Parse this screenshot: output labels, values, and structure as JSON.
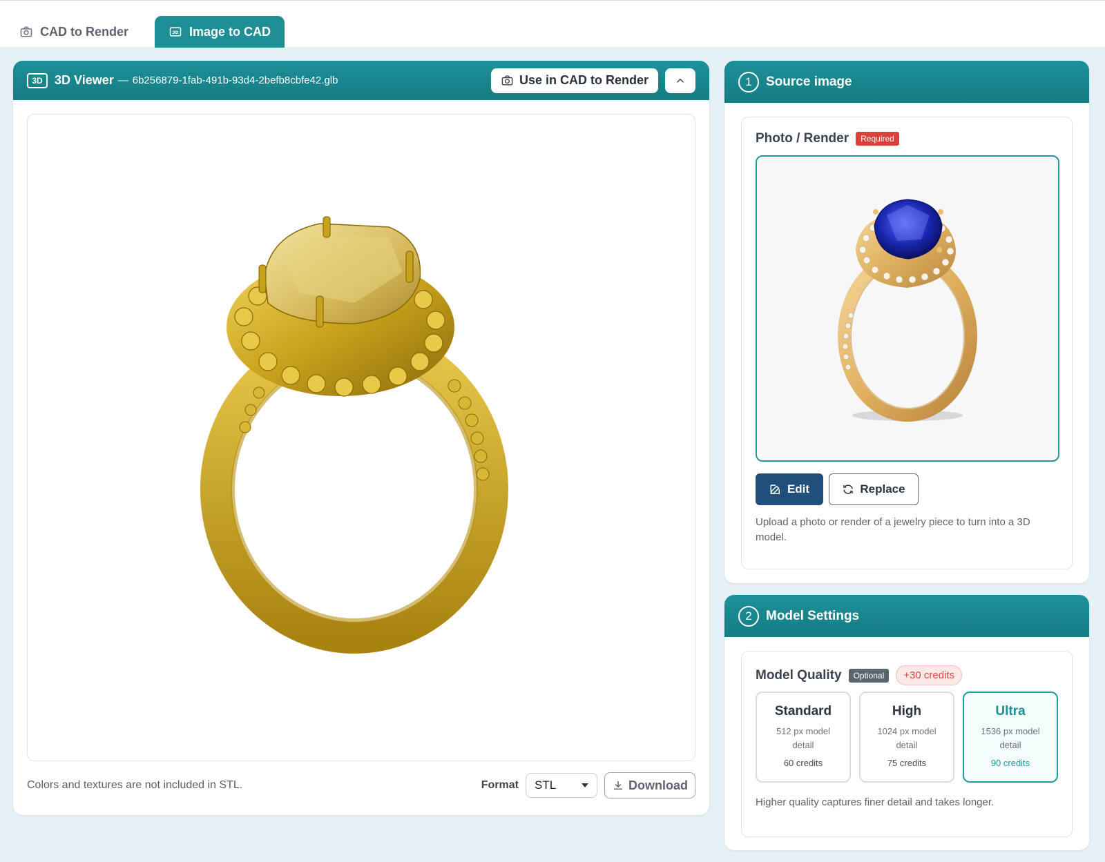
{
  "tabs": [
    {
      "label": "CAD to Render",
      "active": false,
      "icon": "camera-icon"
    },
    {
      "label": "Image to CAD",
      "active": true,
      "icon": "3d-box-icon"
    }
  ],
  "viewer": {
    "badge": "3D",
    "title": "3D Viewer",
    "separator": "—",
    "filename": "6b256879-1fab-491b-93d4-2befb8cbfe42.glb",
    "use_button": "Use in CAD to Render",
    "footnote": "Colors and textures are not included in STL.",
    "format_label": "Format",
    "format_value": "STL",
    "download_label": "Download"
  },
  "source": {
    "step": "1",
    "title": "Source image",
    "card_label": "Photo / Render",
    "required_tag": "Required",
    "edit_label": "Edit",
    "replace_label": "Replace",
    "help": "Upload a photo or render of a jewelry piece to turn into a 3D model."
  },
  "settings": {
    "step": "2",
    "title": "Model Settings",
    "card_label": "Model Quality",
    "optional_tag": "Optional",
    "credits_tag": "+30 credits",
    "options": [
      {
        "name": "Standard",
        "desc": "512 px model detail",
        "credits": "60 credits",
        "selected": false
      },
      {
        "name": "High",
        "desc": "1024 px model detail",
        "credits": "75 credits",
        "selected": false
      },
      {
        "name": "Ultra",
        "desc": "1536 px model detail",
        "credits": "90 credits",
        "selected": true
      }
    ],
    "help": "Higher quality captures finer detail and takes longer."
  },
  "colors": {
    "accent": "#1e8f95",
    "edit_button": "#1f4f7a",
    "required": "#d9413a"
  }
}
